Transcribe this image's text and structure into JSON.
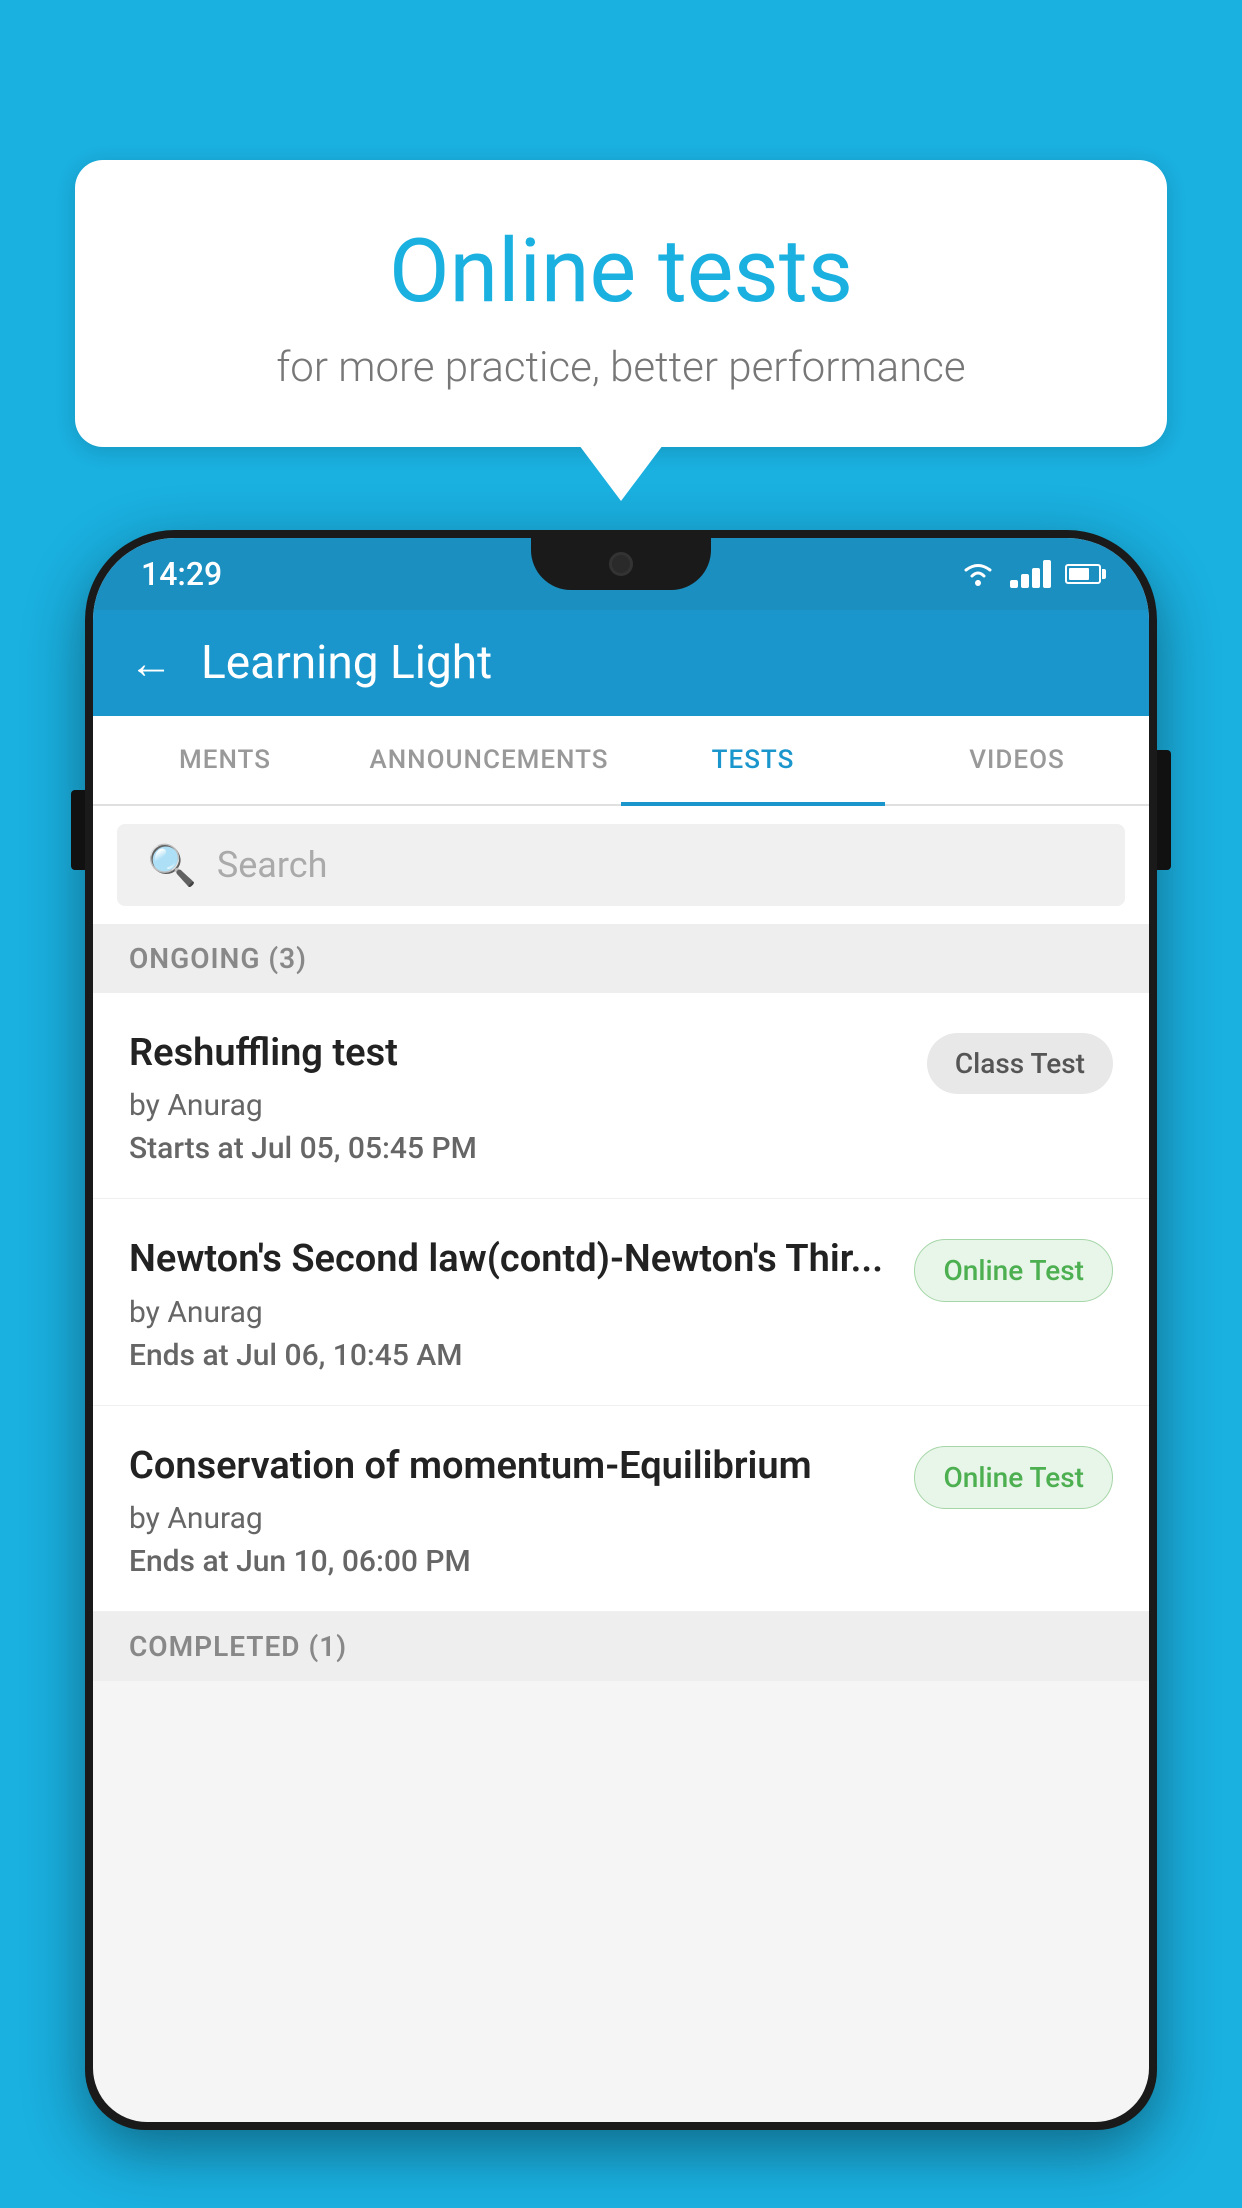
{
  "background_color": "#1ab0e0",
  "speech_bubble": {
    "title": "Online tests",
    "subtitle": "for more practice, better performance"
  },
  "phone": {
    "status_bar": {
      "time": "14:29",
      "wifi_label": "wifi",
      "signal_label": "signal",
      "battery_label": "battery"
    },
    "app_bar": {
      "back_icon": "←",
      "title": "Learning Light"
    },
    "tabs": [
      {
        "label": "MENTS",
        "active": false
      },
      {
        "label": "ANNOUNCEMENTS",
        "active": false
      },
      {
        "label": "TESTS",
        "active": true
      },
      {
        "label": "VIDEOS",
        "active": false
      }
    ],
    "search": {
      "placeholder": "Search",
      "icon": "🔍"
    },
    "ongoing_section": {
      "label": "ONGOING (3)"
    },
    "test_items": [
      {
        "title": "Reshuffling test",
        "author": "by Anurag",
        "date_label": "Starts at",
        "date_value": "Jul 05, 05:45 PM",
        "badge": "Class Test",
        "badge_type": "class"
      },
      {
        "title": "Newton's Second law(contd)-Newton's Thir...",
        "author": "by Anurag",
        "date_label": "Ends at",
        "date_value": "Jul 06, 10:45 AM",
        "badge": "Online Test",
        "badge_type": "online"
      },
      {
        "title": "Conservation of momentum-Equilibrium",
        "author": "by Anurag",
        "date_label": "Ends at",
        "date_value": "Jun 10, 06:00 PM",
        "badge": "Online Test",
        "badge_type": "online"
      }
    ],
    "completed_section": {
      "label": "COMPLETED (1)"
    }
  }
}
